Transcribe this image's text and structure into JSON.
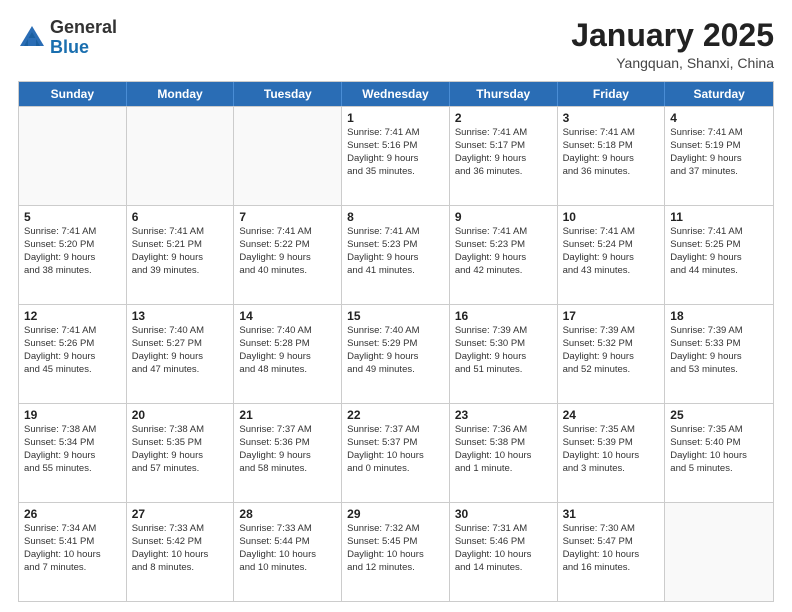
{
  "header": {
    "logo": {
      "general": "General",
      "blue": "Blue"
    },
    "title": "January 2025",
    "subtitle": "Yangquan, Shanxi, China"
  },
  "weekdays": [
    "Sunday",
    "Monday",
    "Tuesday",
    "Wednesday",
    "Thursday",
    "Friday",
    "Saturday"
  ],
  "weeks": [
    [
      {
        "day": "",
        "empty": true,
        "lines": []
      },
      {
        "day": "",
        "empty": true,
        "lines": []
      },
      {
        "day": "",
        "empty": true,
        "lines": []
      },
      {
        "day": "1",
        "lines": [
          "Sunrise: 7:41 AM",
          "Sunset: 5:16 PM",
          "Daylight: 9 hours",
          "and 35 minutes."
        ]
      },
      {
        "day": "2",
        "lines": [
          "Sunrise: 7:41 AM",
          "Sunset: 5:17 PM",
          "Daylight: 9 hours",
          "and 36 minutes."
        ]
      },
      {
        "day": "3",
        "lines": [
          "Sunrise: 7:41 AM",
          "Sunset: 5:18 PM",
          "Daylight: 9 hours",
          "and 36 minutes."
        ]
      },
      {
        "day": "4",
        "lines": [
          "Sunrise: 7:41 AM",
          "Sunset: 5:19 PM",
          "Daylight: 9 hours",
          "and 37 minutes."
        ]
      }
    ],
    [
      {
        "day": "5",
        "lines": [
          "Sunrise: 7:41 AM",
          "Sunset: 5:20 PM",
          "Daylight: 9 hours",
          "and 38 minutes."
        ]
      },
      {
        "day": "6",
        "lines": [
          "Sunrise: 7:41 AM",
          "Sunset: 5:21 PM",
          "Daylight: 9 hours",
          "and 39 minutes."
        ]
      },
      {
        "day": "7",
        "lines": [
          "Sunrise: 7:41 AM",
          "Sunset: 5:22 PM",
          "Daylight: 9 hours",
          "and 40 minutes."
        ]
      },
      {
        "day": "8",
        "lines": [
          "Sunrise: 7:41 AM",
          "Sunset: 5:23 PM",
          "Daylight: 9 hours",
          "and 41 minutes."
        ]
      },
      {
        "day": "9",
        "lines": [
          "Sunrise: 7:41 AM",
          "Sunset: 5:23 PM",
          "Daylight: 9 hours",
          "and 42 minutes."
        ]
      },
      {
        "day": "10",
        "lines": [
          "Sunrise: 7:41 AM",
          "Sunset: 5:24 PM",
          "Daylight: 9 hours",
          "and 43 minutes."
        ]
      },
      {
        "day": "11",
        "lines": [
          "Sunrise: 7:41 AM",
          "Sunset: 5:25 PM",
          "Daylight: 9 hours",
          "and 44 minutes."
        ]
      }
    ],
    [
      {
        "day": "12",
        "lines": [
          "Sunrise: 7:41 AM",
          "Sunset: 5:26 PM",
          "Daylight: 9 hours",
          "and 45 minutes."
        ]
      },
      {
        "day": "13",
        "lines": [
          "Sunrise: 7:40 AM",
          "Sunset: 5:27 PM",
          "Daylight: 9 hours",
          "and 47 minutes."
        ]
      },
      {
        "day": "14",
        "lines": [
          "Sunrise: 7:40 AM",
          "Sunset: 5:28 PM",
          "Daylight: 9 hours",
          "and 48 minutes."
        ]
      },
      {
        "day": "15",
        "lines": [
          "Sunrise: 7:40 AM",
          "Sunset: 5:29 PM",
          "Daylight: 9 hours",
          "and 49 minutes."
        ]
      },
      {
        "day": "16",
        "lines": [
          "Sunrise: 7:39 AM",
          "Sunset: 5:30 PM",
          "Daylight: 9 hours",
          "and 51 minutes."
        ]
      },
      {
        "day": "17",
        "lines": [
          "Sunrise: 7:39 AM",
          "Sunset: 5:32 PM",
          "Daylight: 9 hours",
          "and 52 minutes."
        ]
      },
      {
        "day": "18",
        "lines": [
          "Sunrise: 7:39 AM",
          "Sunset: 5:33 PM",
          "Daylight: 9 hours",
          "and 53 minutes."
        ]
      }
    ],
    [
      {
        "day": "19",
        "lines": [
          "Sunrise: 7:38 AM",
          "Sunset: 5:34 PM",
          "Daylight: 9 hours",
          "and 55 minutes."
        ]
      },
      {
        "day": "20",
        "lines": [
          "Sunrise: 7:38 AM",
          "Sunset: 5:35 PM",
          "Daylight: 9 hours",
          "and 57 minutes."
        ]
      },
      {
        "day": "21",
        "lines": [
          "Sunrise: 7:37 AM",
          "Sunset: 5:36 PM",
          "Daylight: 9 hours",
          "and 58 minutes."
        ]
      },
      {
        "day": "22",
        "lines": [
          "Sunrise: 7:37 AM",
          "Sunset: 5:37 PM",
          "Daylight: 10 hours",
          "and 0 minutes."
        ]
      },
      {
        "day": "23",
        "lines": [
          "Sunrise: 7:36 AM",
          "Sunset: 5:38 PM",
          "Daylight: 10 hours",
          "and 1 minute."
        ]
      },
      {
        "day": "24",
        "lines": [
          "Sunrise: 7:35 AM",
          "Sunset: 5:39 PM",
          "Daylight: 10 hours",
          "and 3 minutes."
        ]
      },
      {
        "day": "25",
        "lines": [
          "Sunrise: 7:35 AM",
          "Sunset: 5:40 PM",
          "Daylight: 10 hours",
          "and 5 minutes."
        ]
      }
    ],
    [
      {
        "day": "26",
        "lines": [
          "Sunrise: 7:34 AM",
          "Sunset: 5:41 PM",
          "Daylight: 10 hours",
          "and 7 minutes."
        ]
      },
      {
        "day": "27",
        "lines": [
          "Sunrise: 7:33 AM",
          "Sunset: 5:42 PM",
          "Daylight: 10 hours",
          "and 8 minutes."
        ]
      },
      {
        "day": "28",
        "lines": [
          "Sunrise: 7:33 AM",
          "Sunset: 5:44 PM",
          "Daylight: 10 hours",
          "and 10 minutes."
        ]
      },
      {
        "day": "29",
        "lines": [
          "Sunrise: 7:32 AM",
          "Sunset: 5:45 PM",
          "Daylight: 10 hours",
          "and 12 minutes."
        ]
      },
      {
        "day": "30",
        "lines": [
          "Sunrise: 7:31 AM",
          "Sunset: 5:46 PM",
          "Daylight: 10 hours",
          "and 14 minutes."
        ]
      },
      {
        "day": "31",
        "lines": [
          "Sunrise: 7:30 AM",
          "Sunset: 5:47 PM",
          "Daylight: 10 hours",
          "and 16 minutes."
        ]
      },
      {
        "day": "",
        "empty": true,
        "lines": []
      }
    ]
  ]
}
